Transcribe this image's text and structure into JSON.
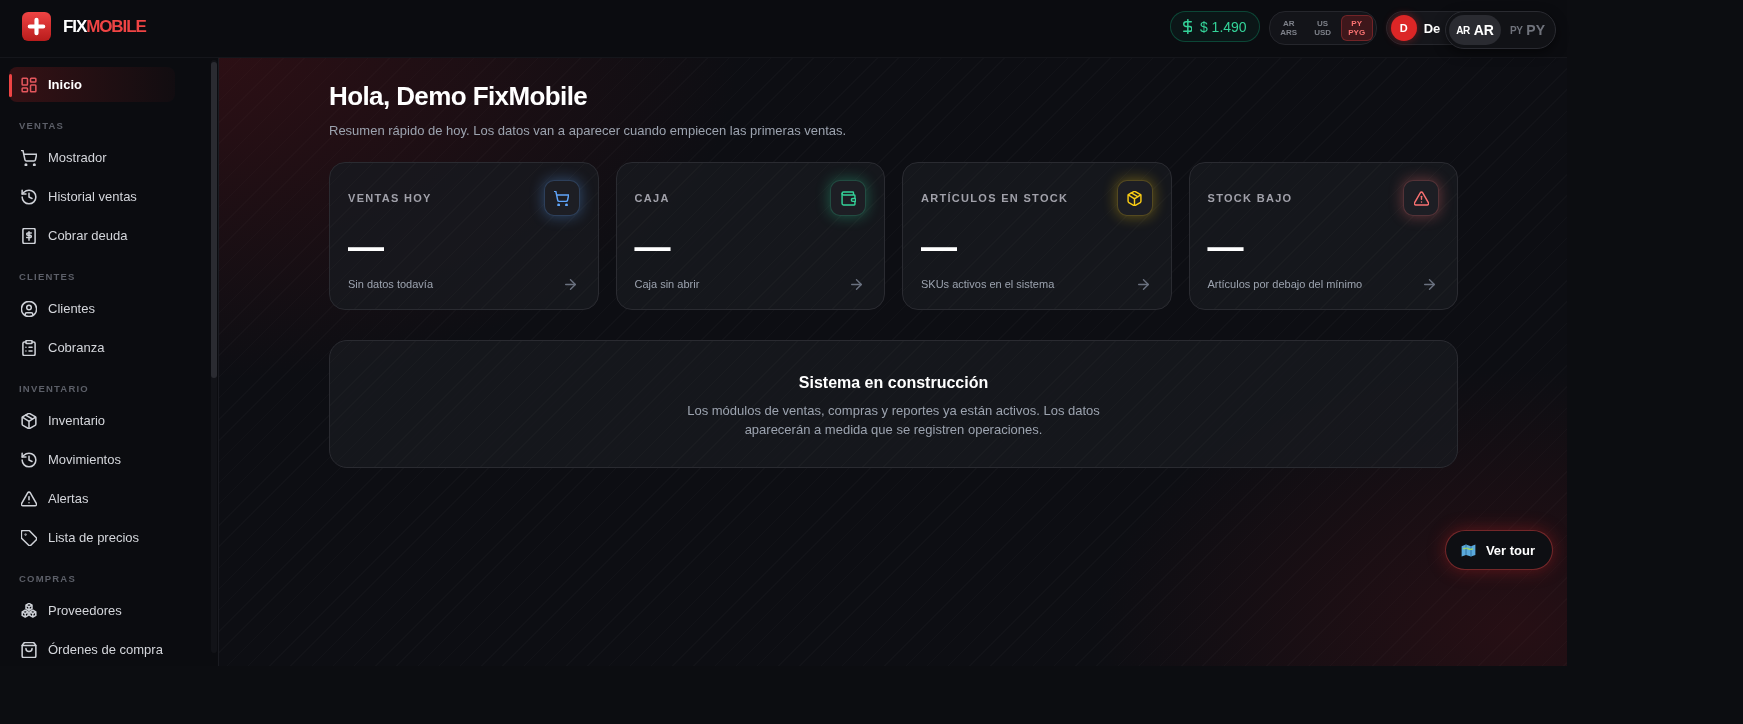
{
  "logo": {
    "text": "FIX",
    "accent_text": "MOBILE"
  },
  "header": {
    "balance": "$ 1.490",
    "currencies": [
      {
        "flag": "AR",
        "code": "ARS",
        "selected": false
      },
      {
        "flag": "US",
        "code": "USD",
        "selected": false
      },
      {
        "flag": "PY",
        "code": "PYG",
        "selected": true
      }
    ],
    "user": {
      "initial": "D",
      "name": "De"
    },
    "languages": [
      {
        "flag": "AR",
        "label": "AR",
        "selected": true
      },
      {
        "flag": "PY",
        "label": "PY",
        "selected": false
      }
    ]
  },
  "sidebar": {
    "sections": [
      {
        "items": [
          {
            "label": "Inicio",
            "selected": true
          }
        ]
      },
      {
        "title": "VENTAS",
        "items": [
          {
            "label": "Mostrador",
            "selected": false
          },
          {
            "label": "Historial ventas",
            "selected": false
          },
          {
            "label": "Cobrar deuda",
            "selected": false
          }
        ]
      },
      {
        "title": "CLIENTES",
        "items": [
          {
            "label": "Clientes",
            "selected": false
          },
          {
            "label": "Cobranza",
            "selected": false
          }
        ]
      },
      {
        "title": "INVENTARIO",
        "items": [
          {
            "label": "Inventario",
            "selected": false
          },
          {
            "label": "Movimientos",
            "selected": false
          },
          {
            "label": "Alertas",
            "selected": false
          },
          {
            "label": "Lista de precios",
            "selected": false
          }
        ]
      },
      {
        "title": "COMPRAS",
        "items": [
          {
            "label": "Proveedores",
            "selected": false
          },
          {
            "label": "Órdenes de compra",
            "selected": false
          }
        ]
      }
    ]
  },
  "main": {
    "title": "Hola, Demo FixMobile",
    "subtitle": "Resumen rápido de hoy. Los datos van a aparecer cuando empiecen las primeras ventas.",
    "cards": [
      {
        "label": "VENTAS HOY",
        "value": "—",
        "caption": "Sin datos todavía",
        "color": "#60a5fa"
      },
      {
        "label": "CAJA",
        "value": "—",
        "caption": "Caja sin abrir",
        "color": "#34d399"
      },
      {
        "label": "ARTÍCULOS EN STOCK",
        "value": "—",
        "caption": "SKUs activos en el sistema",
        "color": "#facc15"
      },
      {
        "label": "STOCK BAJO",
        "value": "—",
        "caption": "Artículos por debajo del mínimo",
        "color": "#f87171"
      }
    ],
    "notice": {
      "title": "Sistema en construcción",
      "text": "Los módulos de ventas, compras y reportes ya están activos. Los datos aparecerán a medida que se registren operaciones."
    },
    "tour_button": "Ver tour"
  }
}
